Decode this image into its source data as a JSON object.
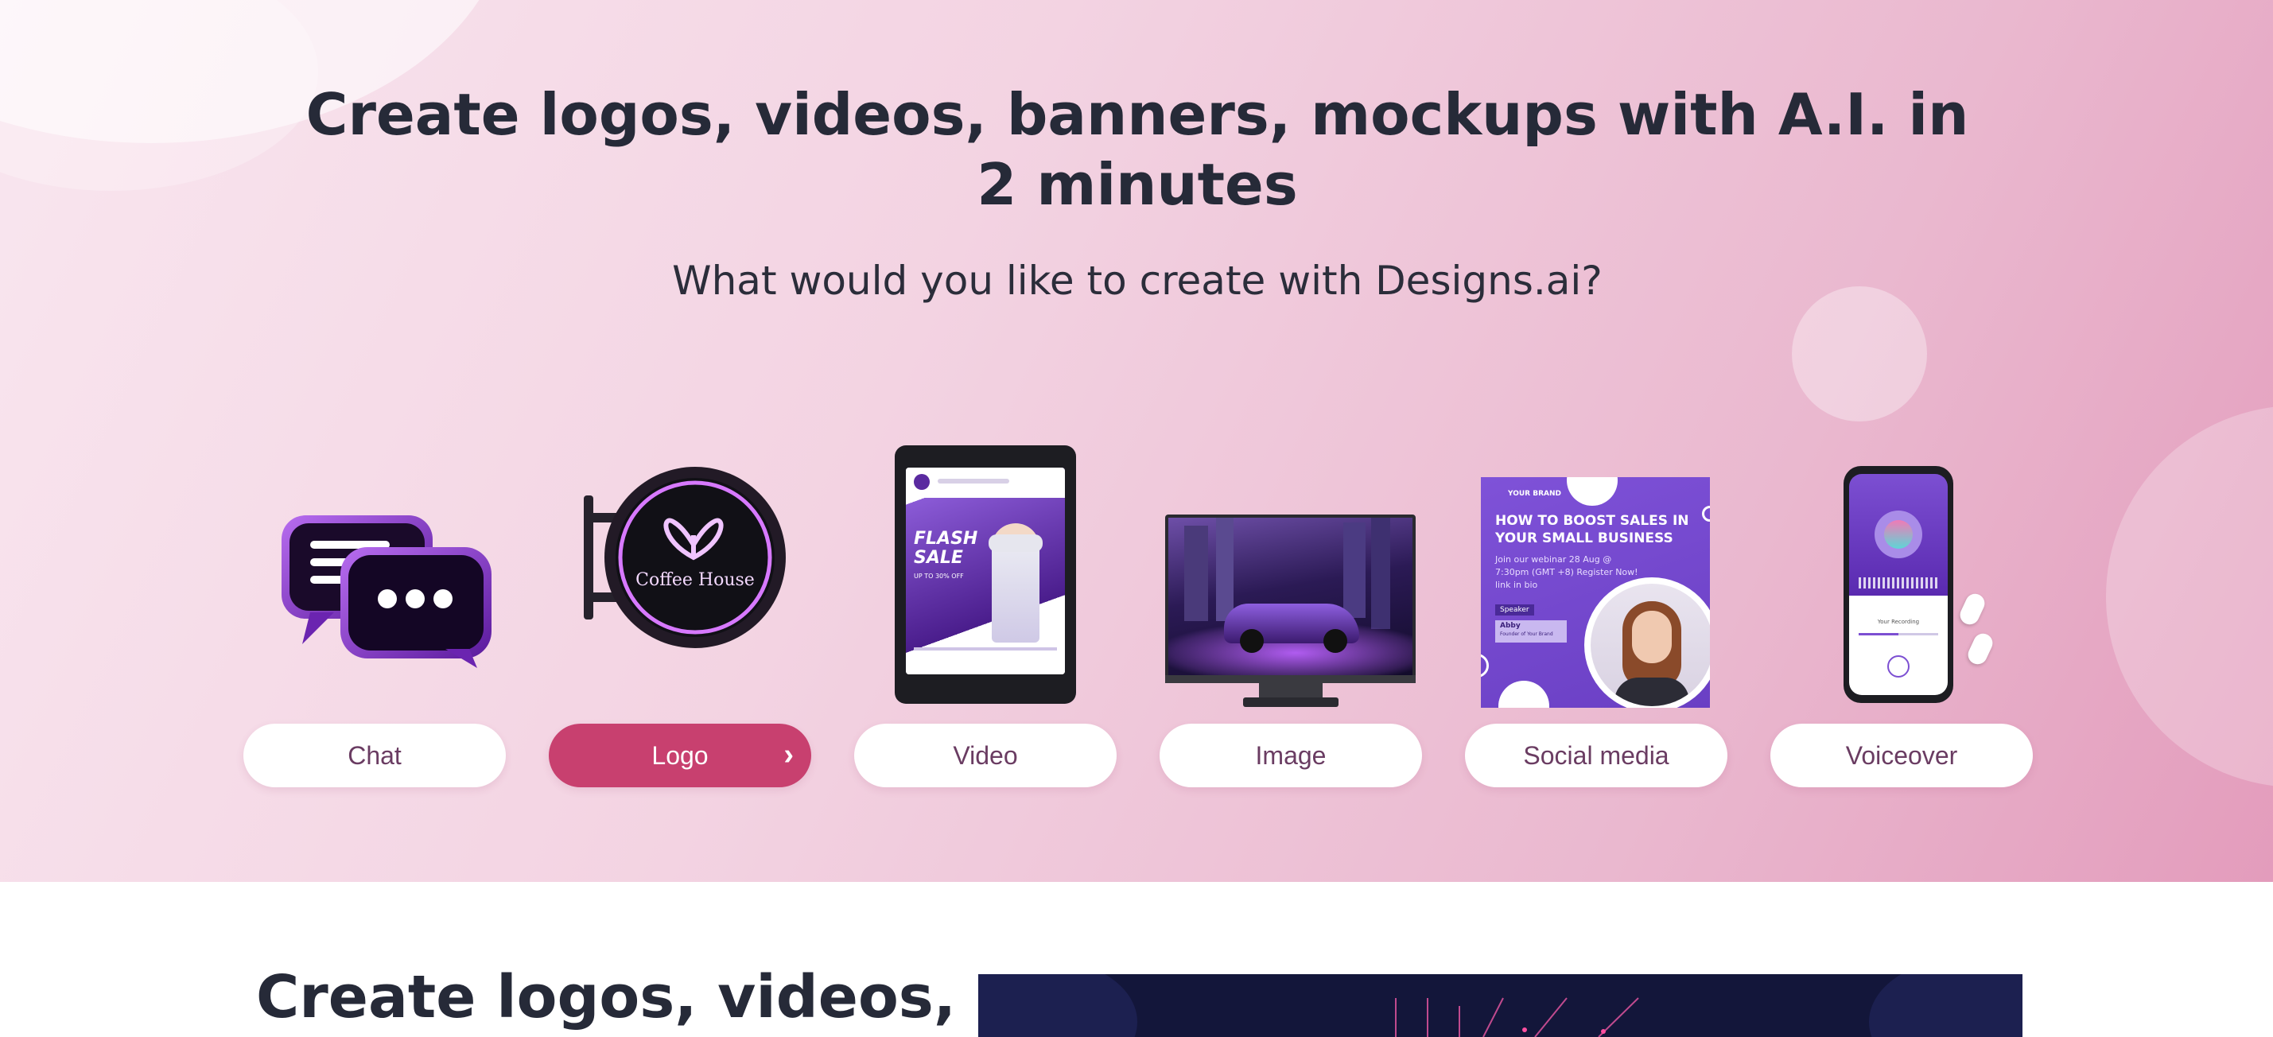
{
  "hero": {
    "headline": "Create logos, videos, banners, mockups with A.I. in 2 minutes",
    "subhead": "What would you like to create with Designs.ai?"
  },
  "categories": [
    {
      "label": "Chat",
      "icon": "chat-bubbles-icon",
      "active": false
    },
    {
      "label": "Logo",
      "icon": "coffee-house-sign-icon",
      "active": true,
      "sign_text": "Coffee House"
    },
    {
      "label": "Video",
      "icon": "tablet-video-icon",
      "active": false,
      "ad_title": "FLASH SALE",
      "ad_sub": "UP TO 30% OFF"
    },
    {
      "label": "Image",
      "icon": "monitor-car-icon",
      "active": false
    },
    {
      "label": "Social media",
      "icon": "social-post-icon",
      "active": false,
      "brand": "YOUR BRAND",
      "post_title": "HOW TO BOOST SALES IN YOUR SMALL BUSINESS",
      "post_body": "Join our webinar 28 Aug @ 7:30pm (GMT +8) Register Now! link in bio",
      "speaker_label": "Speaker",
      "speaker_name": "Abby",
      "speaker_role": "Founder of Your Brand"
    },
    {
      "label": "Voiceover",
      "icon": "phone-voice-icon",
      "active": false,
      "recording_label": "Your Recording"
    }
  ],
  "lower": {
    "title": "Create logos, videos,"
  },
  "colors": {
    "accent": "#c8406f",
    "purple": "#7b3fd1",
    "text_dark": "#262a38"
  }
}
